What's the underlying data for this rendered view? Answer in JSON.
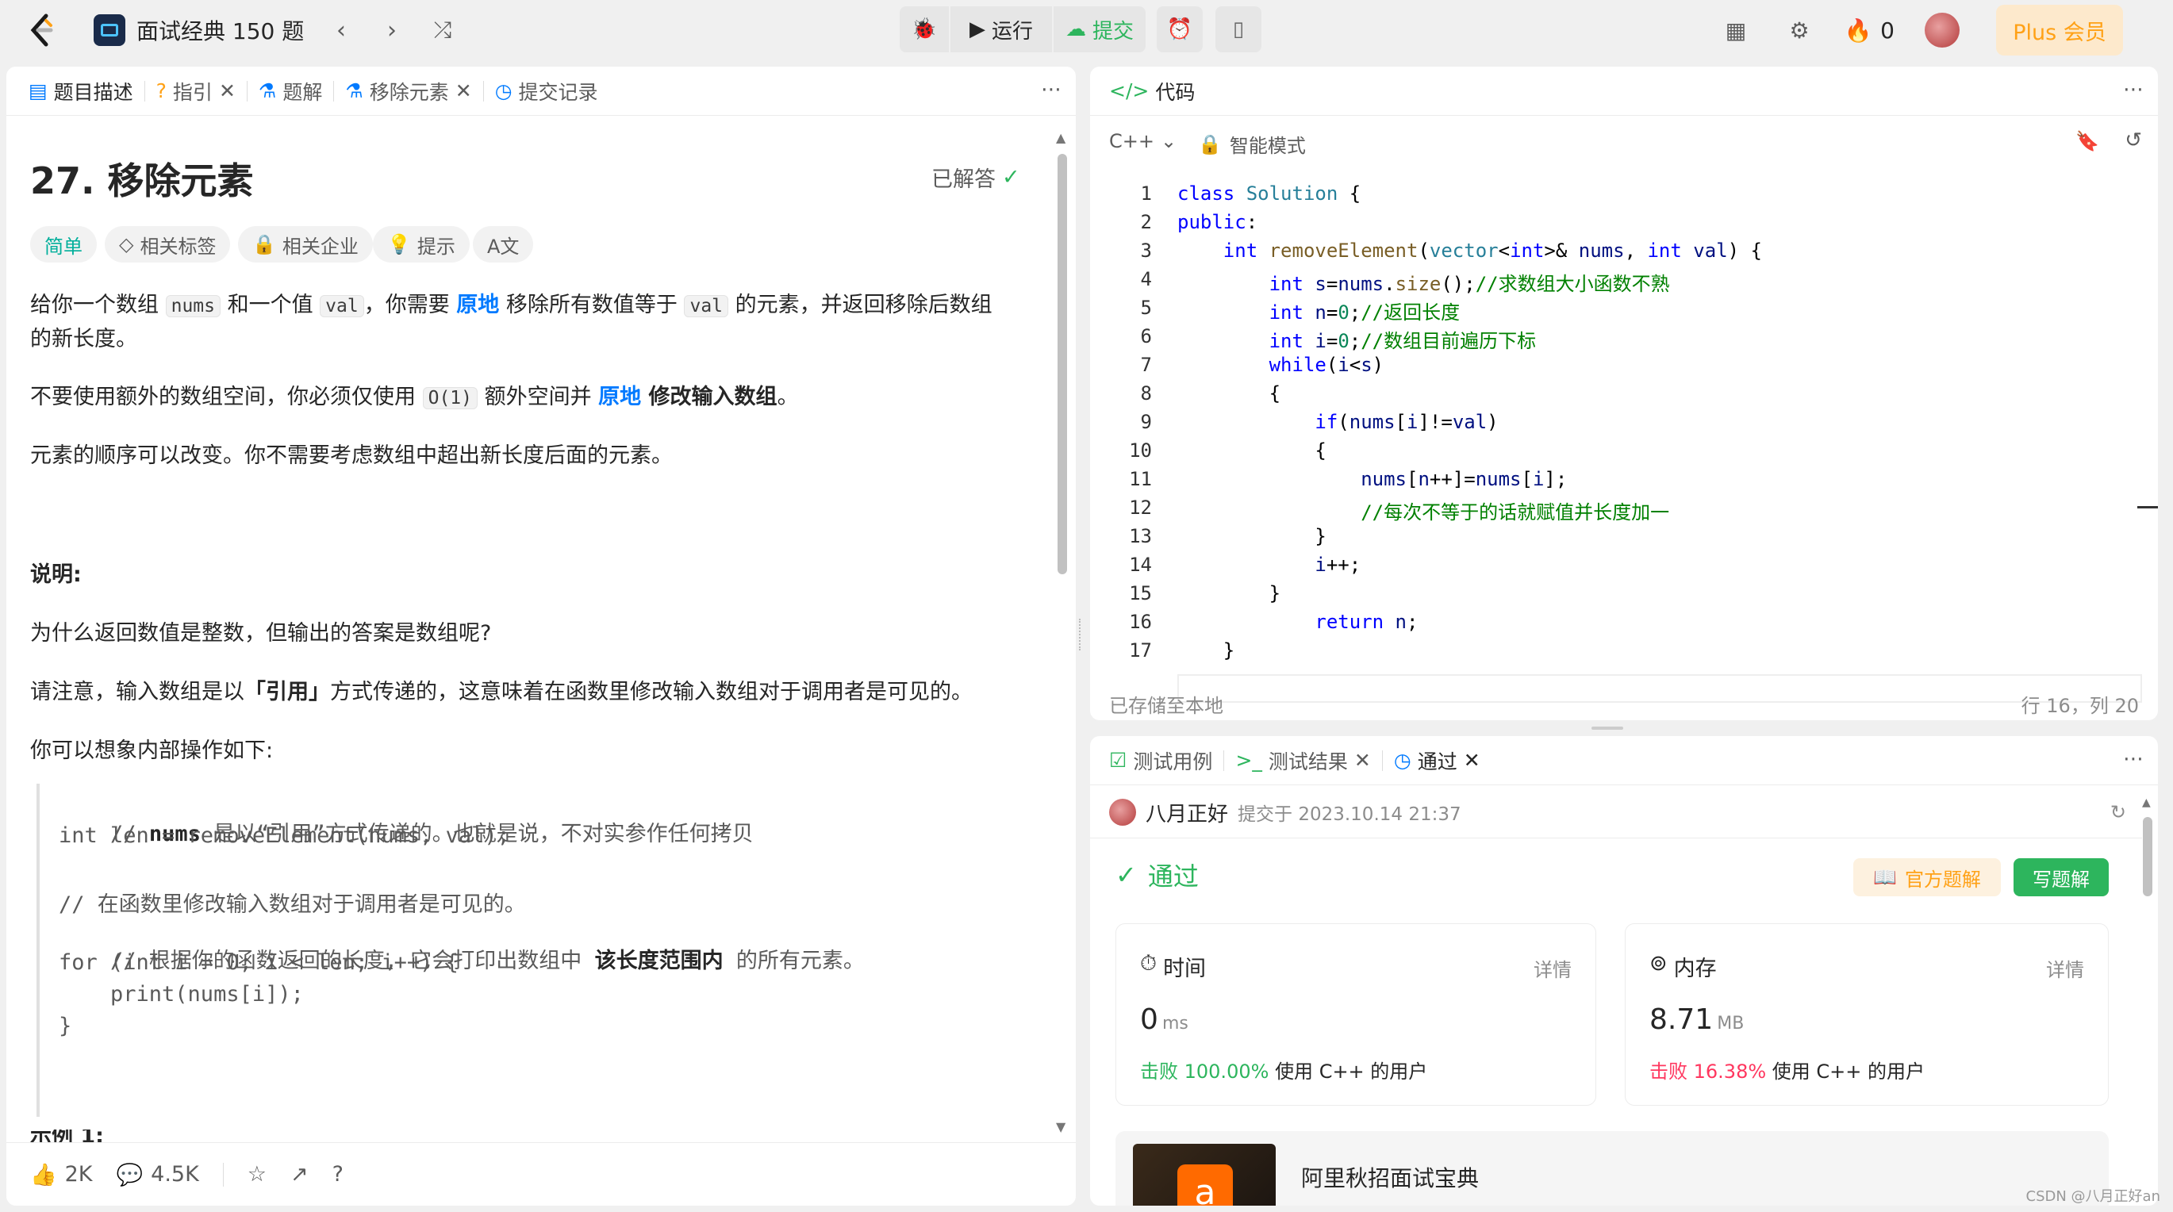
{
  "topbar": {
    "title": "面试经典 150 题",
    "run_label": "运行",
    "submit_label": "提交",
    "streak_count": "0",
    "plus_label": "Plus 会员"
  },
  "left_tabs": [
    {
      "label": "题目描述"
    },
    {
      "label": "指引"
    },
    {
      "label": "题解"
    },
    {
      "label": "移除元素"
    },
    {
      "label": "提交记录"
    }
  ],
  "problem": {
    "title": "27. 移除元素",
    "solved_label": "已解答",
    "difficulty": "简单",
    "chips": [
      "相关标签",
      "相关企业",
      "提示"
    ],
    "p1": {
      "a": "给你一个数组 ",
      "c1": "nums",
      "b": " 和一个值 ",
      "c2": "val",
      "d": "，你需要 ",
      "e": "原地",
      "f": " 移除所有数值等于 ",
      "c3": "val",
      "g": " 的元素，并返回移除后数组",
      "h": "的新长度。"
    },
    "p2": {
      "a": "不要使用额外的数组空间，你必须仅使用 ",
      "c": "O(1)",
      "b": " 额外空间并 ",
      "e": "原地",
      "f": " 修改输入数组",
      "g": "。"
    },
    "p3": "元素的顺序可以改变。你不需要考虑数组中超出新长度后面的元素。",
    "note_title": "说明:",
    "note_q": "为什么返回数值是整数，但输出的答案是数组呢?",
    "note_p": {
      "a": "请注意，输入数组是以",
      "b": "「引用」",
      "c": "方式传递的，这意味着在函数里修改输入数组对于调用者是可见的。"
    },
    "note_p2": "你可以想象内部操作如下:",
    "quote": {
      "l1a": "// ",
      "l1b": "nums",
      "l1c": " 是以“引用”方式传递的。也就是说，不对实参作任何拷贝",
      "l2": "int len = removeElement(nums, val);",
      "l3": "// 在函数里修改输入数组对于调用者是可见的。",
      "l4a": "// 根据你的函数返回的长度, 它会打印出数组中 ",
      "l4b": "该长度范围内",
      "l4c": " 的所有元素。",
      "l5": "for (int i = 0; i < len; i++) {",
      "l6": "    print(nums[i]);",
      "l7": "}"
    },
    "example_cut": "示例 1:"
  },
  "footer": {
    "likes": "2K",
    "comments": "4.5K"
  },
  "code_panel": {
    "title": "代码",
    "language": "C++",
    "mode": "智能模式",
    "saved": "已存储至本地",
    "cursor": "行 16，列 20",
    "line_numbers": [
      "1",
      "2",
      "3",
      "4",
      "5",
      "6",
      "7",
      "8",
      "9",
      "10",
      "11",
      "12",
      "13",
      "14",
      "15",
      "16",
      "17"
    ]
  },
  "result_tabs": [
    {
      "label": "测试用例"
    },
    {
      "label": "测试结果"
    },
    {
      "label": "通过"
    }
  ],
  "result": {
    "user": "八月正好",
    "submitted": "提交于 2023.10.14 21:37",
    "status": "通过",
    "official_label": "官方题解",
    "write_label": "写题解",
    "time_label": "时间",
    "time_value": "0",
    "time_unit": "ms",
    "time_beat_pct": "击败 100.00%",
    "time_beat_rest": "使用 C++ 的用户",
    "mem_label": "内存",
    "mem_value": "8.71",
    "mem_unit": "MB",
    "mem_beat_pct": "击败 16.38%",
    "mem_beat_rest": "使用 C++ 的用户",
    "detail_label": "详情",
    "ad_title": "阿里秋招面试宝典"
  },
  "watermark": "CSDN @八月正好an",
  "colors": {
    "accent_green": "#2db55d",
    "brand_orange": "#ffa116",
    "blue": "#007aff",
    "red": "#ff375f"
  }
}
